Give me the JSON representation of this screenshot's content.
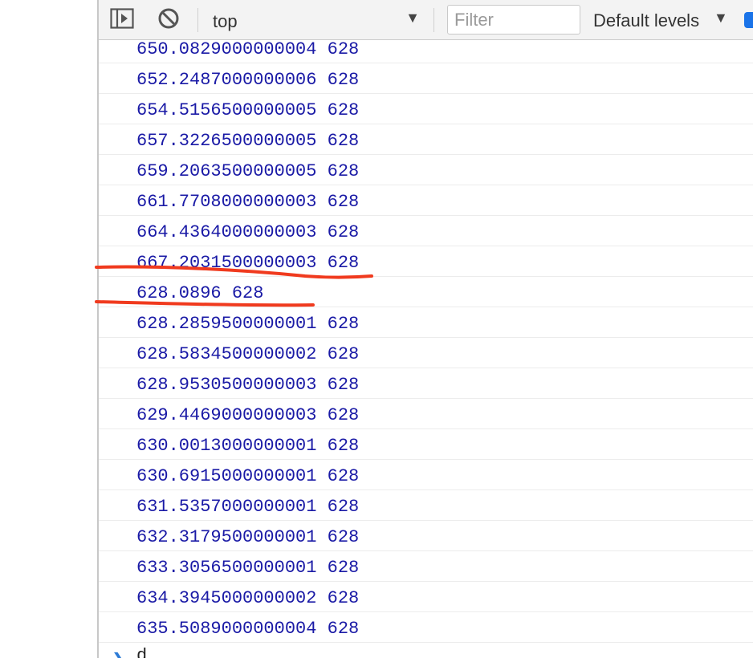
{
  "toolbar": {
    "context": "top",
    "filter_placeholder": "Filter",
    "levels": "Default levels",
    "icons": {
      "sidebar": "sidebar-toggle-icon",
      "clear": "clear-console-icon",
      "dropdown": "dropdown-arrow-icon"
    }
  },
  "console": {
    "messages": [
      "650.0829000000004 628",
      "652.2487000000006 628",
      "654.5156500000005 628",
      "657.3226500000005 628",
      "659.2063500000005 628",
      "661.7708000000003 628",
      "664.4364000000003 628",
      "667.2031500000003 628",
      "628.0896 628",
      "628.2859500000001 628",
      "628.5834500000002 628",
      "628.9530500000003 628",
      "629.4469000000003 628",
      "630.0013000000001 628",
      "630.6915000000001 628",
      "631.5357000000001 628",
      "632.3179500000001 628",
      "633.3056500000001 628",
      "634.3945000000002 628",
      "635.5089000000004 628"
    ],
    "prompt_input": "d"
  },
  "colors": {
    "message_text": "#1a1aa6",
    "annotation": "#f03a1e",
    "prompt_chevron": "#2d7bd6"
  }
}
